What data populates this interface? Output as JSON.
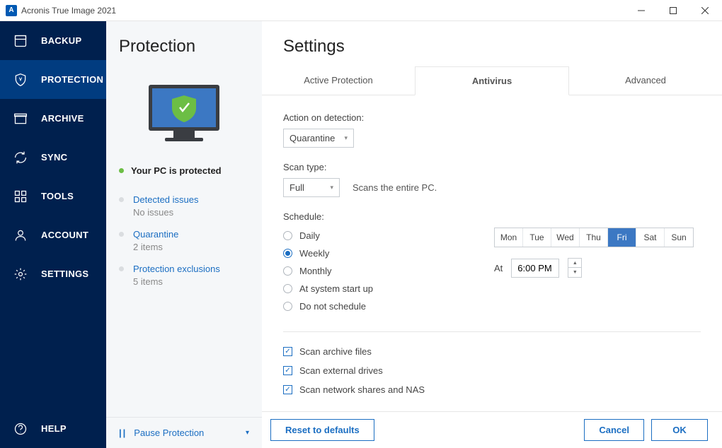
{
  "titlebar": {
    "title": "Acronis True Image 2021",
    "icon_letter": "A"
  },
  "sidebar": {
    "items": [
      {
        "label": "BACKUP"
      },
      {
        "label": "PROTECTION"
      },
      {
        "label": "ARCHIVE"
      },
      {
        "label": "SYNC"
      },
      {
        "label": "TOOLS"
      },
      {
        "label": "ACCOUNT"
      },
      {
        "label": "SETTINGS"
      }
    ],
    "help": "HELP"
  },
  "sub_panel": {
    "title": "Protection",
    "status": "Your PC is protected",
    "links": [
      {
        "title": "Detected issues",
        "sub": "No issues"
      },
      {
        "title": "Quarantine",
        "sub": "2 items"
      },
      {
        "title": "Protection exclusions",
        "sub": "5 items"
      }
    ],
    "pause": "Pause Protection"
  },
  "content": {
    "title": "Settings",
    "tabs": [
      "Active Protection",
      "Antivirus",
      "Advanced"
    ],
    "action_label": "Action on detection:",
    "action_value": "Quarantine",
    "scan_type_label": "Scan type:",
    "scan_type_value": "Full",
    "scan_type_note": "Scans the entire PC.",
    "schedule_label": "Schedule:",
    "schedule_opts": [
      "Daily",
      "Weekly",
      "Monthly",
      "At system start up",
      "Do not schedule"
    ],
    "days": [
      "Mon",
      "Tue",
      "Wed",
      "Thu",
      "Fri",
      "Sat",
      "Sun"
    ],
    "time_at": "At",
    "time_value": "6:00 PM",
    "checks": [
      "Scan archive files",
      "Scan external drives",
      "Scan network shares and NAS"
    ]
  },
  "footer": {
    "reset": "Reset to defaults",
    "cancel": "Cancel",
    "ok": "OK"
  }
}
